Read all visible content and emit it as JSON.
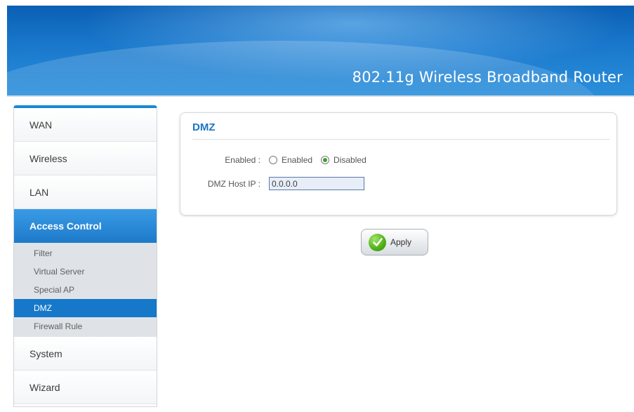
{
  "header": {
    "title": "802.11g Wireless Broadband Router"
  },
  "sidebar": {
    "items": [
      {
        "label": "WAN"
      },
      {
        "label": "Wireless"
      },
      {
        "label": "LAN"
      },
      {
        "label": "Access Control",
        "active": true
      },
      {
        "label": "System"
      },
      {
        "label": "Wizard"
      }
    ],
    "submenu": [
      {
        "label": "Filter"
      },
      {
        "label": "Virtual Server"
      },
      {
        "label": "Special AP"
      },
      {
        "label": "DMZ",
        "active": true
      },
      {
        "label": "Firewall Rule"
      }
    ]
  },
  "panel": {
    "title": "DMZ",
    "enabled_label": "Enabled :",
    "enabled_options": [
      {
        "label": "Enabled",
        "selected": false
      },
      {
        "label": "Disabled",
        "selected": true
      }
    ],
    "host_ip_label": "DMZ Host IP :",
    "host_ip_value": "0.0.0.0"
  },
  "apply_button": {
    "label": "Apply"
  },
  "colors": {
    "accent": "#1d74c4",
    "nav_active": "#1678c9",
    "apply_check": "#53b51c"
  }
}
